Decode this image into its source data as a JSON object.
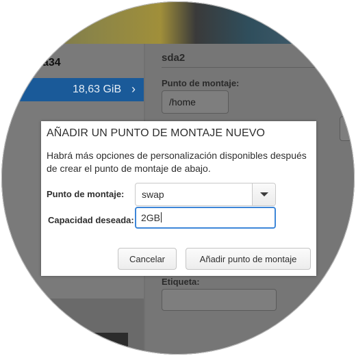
{
  "background": {
    "left_pane": {
      "header": "a34",
      "selected_size": "18,63 GiB"
    },
    "right_pane": {
      "device": "sda2",
      "mount_point_label": "Punto de montaje:",
      "mount_point_value": "/home",
      "label_label": "Etiqueta:"
    }
  },
  "dialog": {
    "title": "AÑADIR UN PUNTO DE MONTAJE NUEVO",
    "description": "Habrá más opciones de personalización disponibles después de crear el punto de montaje de abajo.",
    "mount_point_label": "Punto de montaje:",
    "mount_point_value": "swap",
    "capacity_label": "Capacidad deseada:",
    "capacity_value": "2GB",
    "cancel_label": "Cancelar",
    "add_label": "Añadir punto de montaje"
  },
  "colors": {
    "selection": "#1a5a99",
    "focus_border": "#3d86d8"
  },
  "icons": {
    "dropdown": "triangle-down",
    "row_arrow": "chevron-right"
  }
}
